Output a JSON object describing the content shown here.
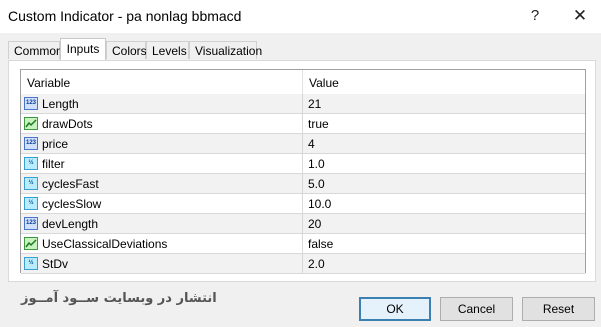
{
  "window": {
    "title": "Custom Indicator - pa nonlag bbmacd",
    "help_label": "?",
    "close_label": "✕"
  },
  "tabs": [
    {
      "label": "Common",
      "active": false
    },
    {
      "label": "Inputs",
      "active": true
    },
    {
      "label": "Colors",
      "active": false
    },
    {
      "label": "Levels",
      "active": false
    },
    {
      "label": "Visualization",
      "active": false
    }
  ],
  "grid": {
    "headers": {
      "variable": "Variable",
      "value": "Value"
    },
    "rows": [
      {
        "icon": "int-icon",
        "icon_text": "123",
        "name": "Length",
        "value": "21"
      },
      {
        "icon": "bool-icon",
        "icon_text": "",
        "name": "drawDots",
        "value": "true"
      },
      {
        "icon": "int-icon",
        "icon_text": "123",
        "name": "price",
        "value": "4"
      },
      {
        "icon": "double-icon",
        "icon_text": "½",
        "name": "filter",
        "value": "1.0"
      },
      {
        "icon": "double-icon",
        "icon_text": "½",
        "name": "cyclesFast",
        "value": "5.0"
      },
      {
        "icon": "double-icon",
        "icon_text": "½",
        "name": "cyclesSlow",
        "value": "10.0"
      },
      {
        "icon": "int-icon",
        "icon_text": "123",
        "name": "devLength",
        "value": "20"
      },
      {
        "icon": "bool-icon",
        "icon_text": "",
        "name": "UseClassicalDeviations",
        "value": "false"
      },
      {
        "icon": "double-icon",
        "icon_text": "½",
        "name": "StDv",
        "value": "2.0"
      }
    ]
  },
  "watermark": "انتشار در وبسایت ســود آمــوز",
  "buttons": {
    "ok": "OK",
    "cancel": "Cancel",
    "reset": "Reset"
  }
}
